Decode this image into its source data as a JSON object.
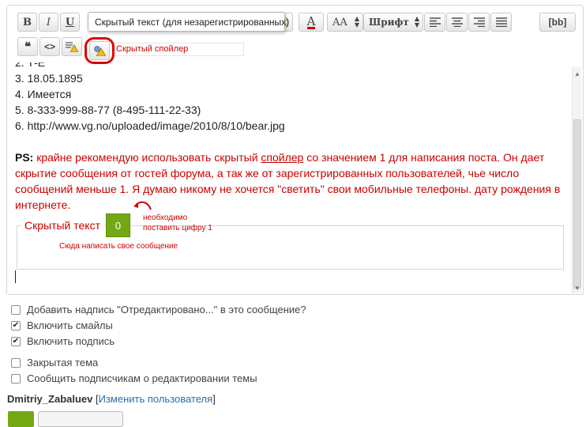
{
  "toolbar": {
    "bold": "B",
    "italic": "I",
    "underline": "U",
    "tooltip": "Скрытый текст (для незарегистрированных)",
    "font_size": "AA",
    "font_name": "Шрифт",
    "bb": "[bb]",
    "quote": "66",
    "code": "<>",
    "annotation_spoiler": "Скрытый спойлер",
    "colors": {
      "accent_red": "#e00000",
      "font_color_underline": "#cc0000"
    }
  },
  "content": {
    "lines": [
      "2. Т-Е",
      "3. 18.05.1895",
      "4. Имеется",
      "5. 8-333-999-88-77 (8-495-111-22-33)",
      "6. http://www.vg.no/uploaded/image/2010/8/10/bear.jpg"
    ],
    "ps_label": "PS:",
    "ps_text_1": " крайне рекомендую использовать скрытый ",
    "ps_link": "спойлер",
    "ps_text_2": " со значением 1 для написания поста. Он дает скрытие сообщения от гостей форума, а так же от зарегистрированных пользователей, чье число сообщений меньше 1. Я думаю никому не хочется \"светить\" свои мобильные телефоны. дату рождения в интернете.",
    "spoiler_legend": "Скрытый текст",
    "spoiler_value": "0",
    "annotation_need_line1": "необходимо",
    "annotation_need_line2": "поставить цифру 1",
    "annotation_write": "Сюда написать свое сообщение"
  },
  "options": [
    {
      "label": "Добавить надпись \"Отредактировано...\" в это сообщение?",
      "checked": false
    },
    {
      "label": "Включить смайлы",
      "checked": true
    },
    {
      "label": "Включить подпись",
      "checked": true
    },
    {
      "label": "Закрытая тема",
      "checked": false
    },
    {
      "label": "Сообщить подписчикам о редактировании темы",
      "checked": false
    }
  ],
  "user": {
    "name": "Dmitriy_Zabaluev",
    "bracket_open": " [",
    "change_link": "Изменить пользователя",
    "bracket_close": "]"
  }
}
